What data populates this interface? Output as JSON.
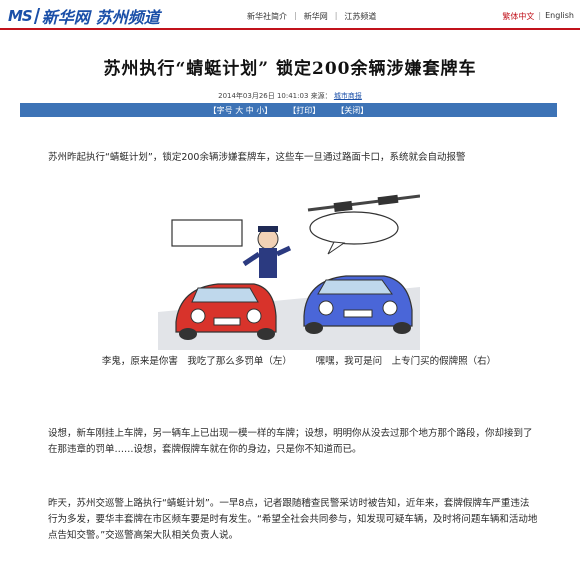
{
  "header": {
    "logo_mark": "MS",
    "logo_brand": "新华网",
    "logo_channel": "苏州频道",
    "nav": [
      "新华社简介",
      "新华网",
      "江苏频道"
    ],
    "lang_simplified": "繁体中文",
    "lang_english": "English"
  },
  "article": {
    "title": "苏州执行“蜻蜓计划” 锁定200余辆涉嫌套牌车",
    "date": "2014年03月26日 10:41:03",
    "source_label": "来源：",
    "source_name": "城市商报",
    "tools": {
      "font_label": "【字号",
      "font_large": "大",
      "font_medium": "中",
      "font_small": "小】",
      "print": "【打印】",
      "close": "【关闭】"
    },
    "para1": "苏州昨起执行“蜻蜓计划”，锁定200余辆涉嫌套牌车，这些车一旦通过路面卡口，系统就会自动报警",
    "caption": "李鬼，原来是你害　我吃了那么多罚单（左）　　　嘿嘿，我可是问　上专门买的假牌照（右）",
    "para2": "设想，新车刚挂上车牌，另一辆车上已出现一模一样的车牌；设想，明明你从没去过那个地方那个路段，你却接到了在那违章的罚单……设想，套牌假牌车就在你的身边，只是你不知道而已。",
    "para3": "昨天，苏州交巡警上路执行“蜻蜓计划”。一早8点，记者跟随稽查民警采访时被告知，近年来，套牌假牌车严重违法行为多发，要华丰套牌在市区频车要是时有发生。“希望全社会共同参与，知发现可疑车辆，及时将问题车辆和活动地点告知交警。”交巡警高架大队相关负责人说。"
  },
  "colors": {
    "brand_blue": "#1a4fa8",
    "brand_red": "#c1121b",
    "toolbar_blue": "#3d73b6",
    "red_car": "#d8332b",
    "blue_car": "#4a66d8"
  }
}
